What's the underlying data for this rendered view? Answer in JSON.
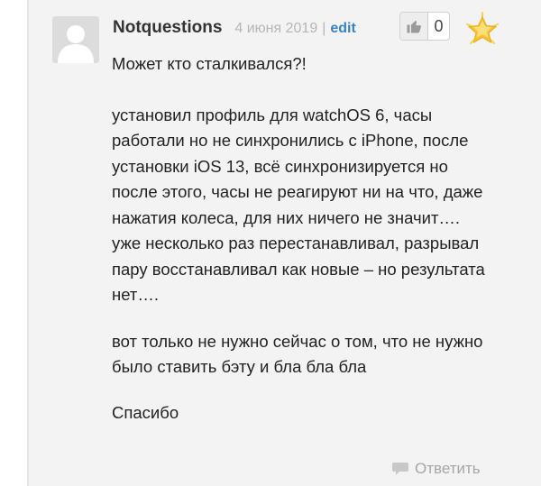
{
  "comment": {
    "author": "Notquestions",
    "date": "4 июня 2019",
    "separator": "|",
    "edit_label": "edit",
    "like_count": "0",
    "badge_icon": "star-badge-icon",
    "paragraphs": [
      "Может кто сталкивался?!",
      "установил профиль для watchOS 6, часы работали но не синхронились с iPhone, после установки iOS 13, всё синхронизируется но после этого, часы не реагируют ни на что, даже нажатия колеса, для них ничего не значит…. уже несколько раз перестанавливал, разрывал пару восстанавливал как новые – но результата нет….",
      "вот только не нужно сейчас о том, что не нужно было ставить бэту и бла бла бла",
      "Спасибо"
    ],
    "reply_label": "Ответить"
  },
  "colors": {
    "panel_bg": "#f3f3f3",
    "edit_link": "#3a82c4",
    "muted": "#b6b6b6",
    "text": "#222222"
  }
}
